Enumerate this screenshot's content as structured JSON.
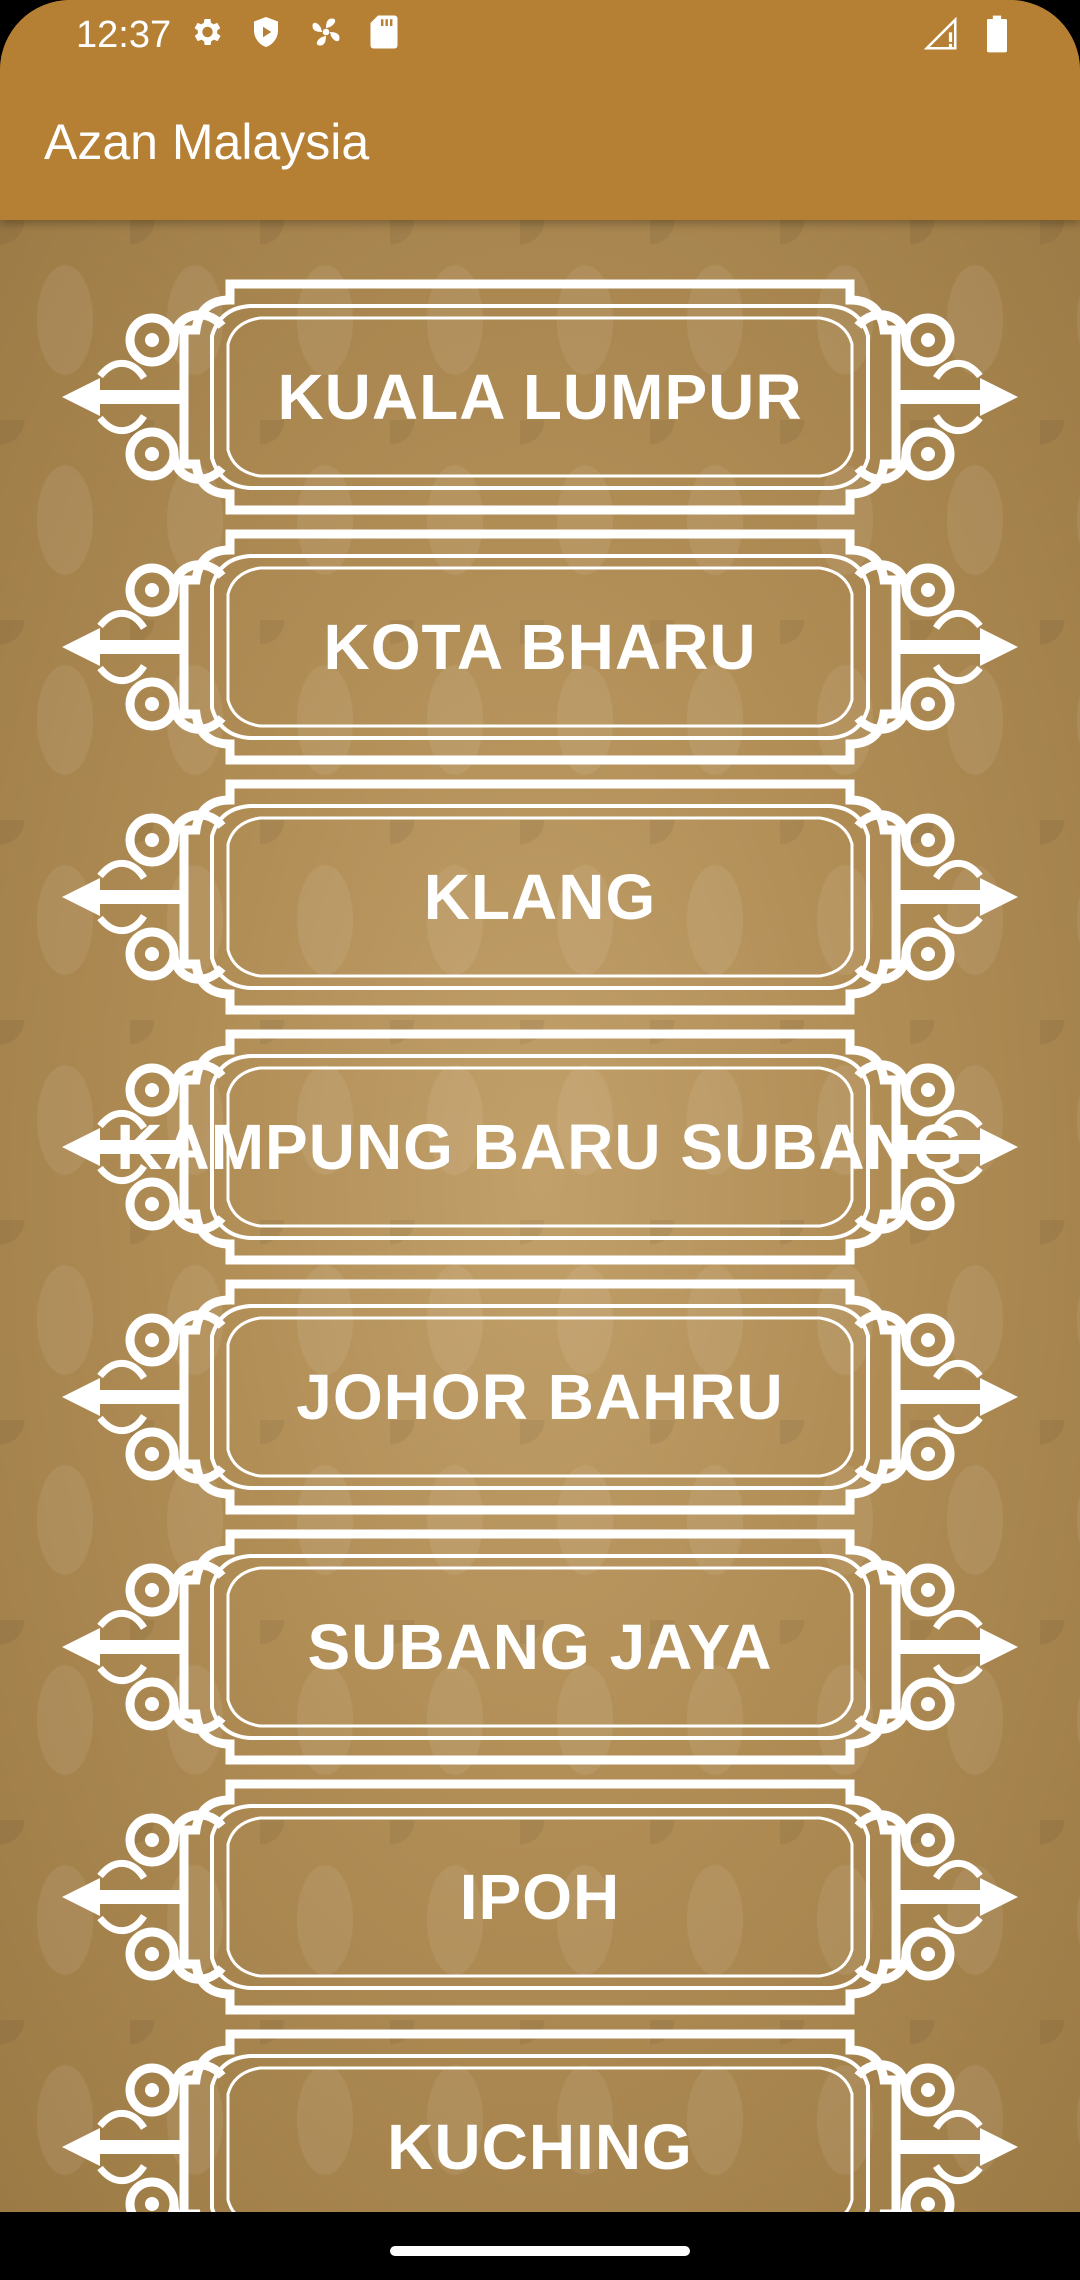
{
  "status_bar": {
    "time": "12:37",
    "left_icons": [
      "gear-icon",
      "shield-play-icon",
      "fan-icon",
      "sd-card-icon"
    ],
    "right_icons": [
      "signal-icon",
      "battery-icon"
    ]
  },
  "app_bar": {
    "title": "Azan Malaysia"
  },
  "cities": [
    {
      "label": "KUALA LUMPUR"
    },
    {
      "label": "KOTA BHARU"
    },
    {
      "label": "KLANG"
    },
    {
      "label": "KAMPUNG BARU SUBANG"
    },
    {
      "label": "JOHOR BAHRU"
    },
    {
      "label": "SUBANG JAYA"
    },
    {
      "label": "IPOH"
    },
    {
      "label": "KUCHING"
    }
  ],
  "colors": {
    "app_bar": "#b68034",
    "background": "#b08d55",
    "frame": "#ffffff"
  }
}
